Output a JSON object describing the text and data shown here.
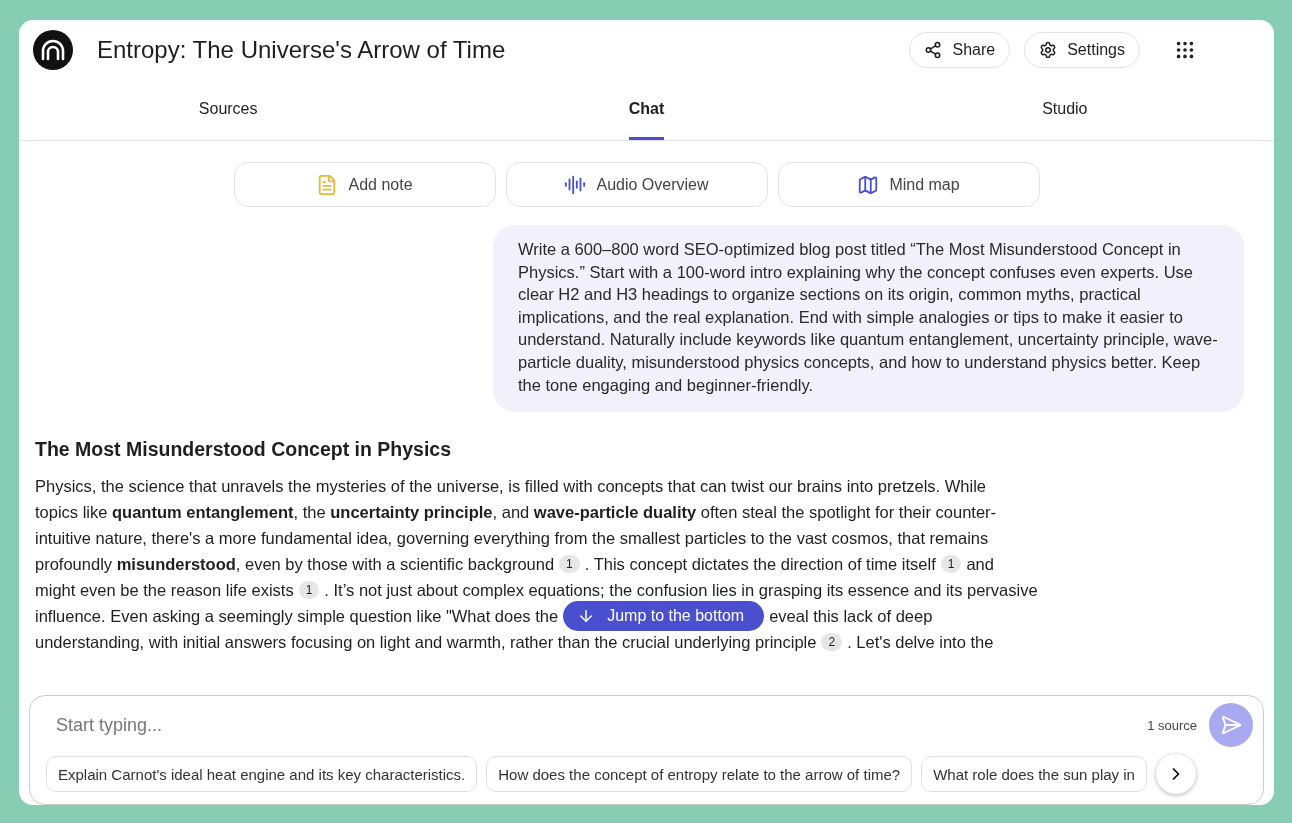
{
  "header": {
    "title": "Entropy: The Universe's Arrow of Time",
    "buttons": [
      {
        "kind": "share",
        "label": "Share"
      },
      {
        "kind": "settings",
        "label": "Settings"
      }
    ]
  },
  "tabs": [
    {
      "label": "Sources",
      "selected": false
    },
    {
      "label": "Chat",
      "selected": true
    },
    {
      "label": "Studio",
      "selected": false
    }
  ],
  "tools": [
    {
      "kind": "note",
      "label": "Add note"
    },
    {
      "kind": "audio",
      "label": "Audio Overview"
    },
    {
      "kind": "map",
      "label": "Mind map"
    }
  ],
  "prompt": "Write a 600–800 word SEO-optimized blog post titled “The Most Misunderstood Concept in Physics.” Start with a 100-word intro explaining why the concept confuses even experts. Use clear H2 and H3 headings to organize sections on its origin, common myths, practical implications, and the real explanation. End with simple analogies or tips to make it easier to understand. Naturally include keywords like quantum entanglement, uncertainty principle, wave-particle duality, misunderstood physics concepts, and how to understand physics better. Keep the tone engaging and beginner-friendly.",
  "response": {
    "heading": "The Most Misunderstood Concept in Physics",
    "lines": [
      [
        {
          "kind": "text",
          "text": "Physics, the science that unravels the mysteries of the universe, is filled with concepts that can twist our brains into pretzels. While"
        }
      ],
      [
        {
          "kind": "text",
          "text": "topics like **quantum entanglement**, the **uncertainty principle**, and **wave-particle duality** often steal the spotlight for their counter-"
        }
      ],
      [
        {
          "kind": "text",
          "text": "intuitive nature, there's a more fundamental idea, governing everything from the smallest particles to the vast cosmos, that remains"
        }
      ],
      [
        {
          "kind": "text",
          "text": "profoundly **misunderstood**, even by those with a scientific background"
        },
        {
          "kind": "citation",
          "text": "1"
        },
        {
          "kind": "text",
          "text": ". This concept dictates the direction of time itself"
        },
        {
          "kind": "citation",
          "text": "1"
        },
        {
          "kind": "text",
          "text": "and"
        }
      ],
      [
        {
          "kind": "text",
          "text": "might even be the reason life exists"
        },
        {
          "kind": "citation",
          "text": "1"
        },
        {
          "kind": "text",
          "text": ". It’s not just about complex equations; the confusion lies in grasping its essence and its pervasive"
        }
      ],
      [
        {
          "kind": "text",
          "text": "influence. Even asking a seemingly simple question like \"What does the"
        },
        {
          "kind": "jump",
          "text": "Jump to the bottom"
        },
        {
          "kind": "text",
          "text": "eveal this lack of deep"
        }
      ],
      [
        {
          "kind": "text",
          "text": "understanding, with initial answers focusing on light and warmth, rather than the crucial underlying principle"
        },
        {
          "kind": "citation",
          "text": "2"
        },
        {
          "kind": "text",
          "text": ". Let's delve into the"
        }
      ]
    ]
  },
  "composer": {
    "placeholder": "Start typing...",
    "source_count": "1 source"
  },
  "suggestions": [
    "Explain Carnot's ideal heat engine and its key characteristics.",
    "How does the concept of entropy relate to the arrow of time?",
    "What role does the sun play in"
  ]
}
